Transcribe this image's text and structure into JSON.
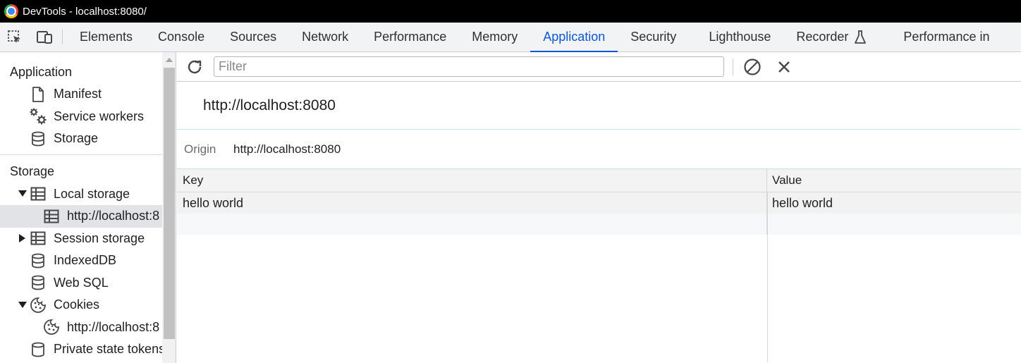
{
  "window": {
    "title": "DevTools - localhost:8080/"
  },
  "tabbar": {
    "tabs": [
      {
        "label": "Elements"
      },
      {
        "label": "Console"
      },
      {
        "label": "Sources"
      },
      {
        "label": "Network"
      },
      {
        "label": "Performance"
      },
      {
        "label": "Memory"
      },
      {
        "label": "Application",
        "active": true
      },
      {
        "label": "Security"
      },
      {
        "label": "Lighthouse"
      },
      {
        "label": "Recorder"
      },
      {
        "label": "Performance in"
      }
    ],
    "icons": [
      "inspect-element-icon",
      "device-toolbar-icon",
      "flask-icon"
    ]
  },
  "sidebar": {
    "application": {
      "title": "Application",
      "items": [
        {
          "label": "Manifest",
          "icon": "document-icon"
        },
        {
          "label": "Service workers",
          "icon": "gears-icon"
        },
        {
          "label": "Storage",
          "icon": "database-icon"
        }
      ]
    },
    "storage": {
      "title": "Storage",
      "items": [
        {
          "label": "Local storage",
          "icon": "table-icon",
          "expanded": true
        },
        {
          "label": "http://localhost:8",
          "icon": "table-icon",
          "selected": true
        },
        {
          "label": "Session storage",
          "icon": "table-icon",
          "expanded": false
        },
        {
          "label": "IndexedDB",
          "icon": "database-icon"
        },
        {
          "label": "Web SQL",
          "icon": "database-icon"
        },
        {
          "label": "Cookies",
          "icon": "cookie-icon",
          "expanded": true
        },
        {
          "label": "http://localhost:8",
          "icon": "cookie-icon"
        },
        {
          "label": "Private state tokens",
          "icon": "database-icon"
        }
      ]
    }
  },
  "toolbar": {
    "filter_placeholder": "Filter",
    "icons": [
      "refresh-icon",
      "clear-all-icon",
      "delete-icon"
    ]
  },
  "main": {
    "origin_title": "http://localhost:8080",
    "origin_label": "Origin",
    "origin_value": "http://localhost:8080",
    "grid": {
      "columns": [
        "Key",
        "Value"
      ],
      "rows": [
        {
          "key": "hello world",
          "value": "hello world"
        }
      ]
    }
  },
  "colors": {
    "accent": "#0b57d0",
    "titlebar": "#000000",
    "tabbar_bg": "#f1f3f4",
    "selected_bg": "#e1e3e6"
  }
}
